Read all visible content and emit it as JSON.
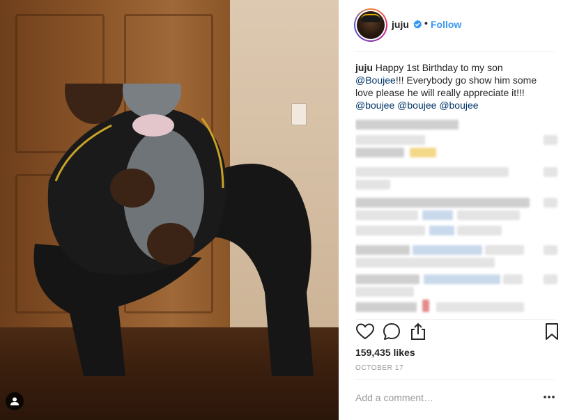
{
  "post": {
    "author": {
      "username": "juju",
      "verified": true,
      "follow_label": "Follow",
      "separator": "•"
    },
    "caption": {
      "username": "juju",
      "text_1": " Happy 1st Birthday to my son ",
      "mention_1": "@Boujee",
      "text_2": "!!! Everybody go show him some love please he will really appreciate it!!! ",
      "mention_2": "@boujee",
      "mention_3": "@boujee",
      "mention_4": "@boujee"
    },
    "likes_label": "159,435 likes",
    "date": "OCTOBER 17",
    "comment_placeholder": "Add a comment…",
    "icons": {
      "like": "heart-icon",
      "comment": "comment-icon",
      "share": "share-icon",
      "save": "bookmark-icon",
      "more": "more-icon",
      "tag": "user-tag-icon",
      "verified": "verified-badge-icon"
    },
    "colors": {
      "accent": "#3897f0",
      "mention": "#003569",
      "muted": "#999999",
      "text": "#262626"
    }
  }
}
